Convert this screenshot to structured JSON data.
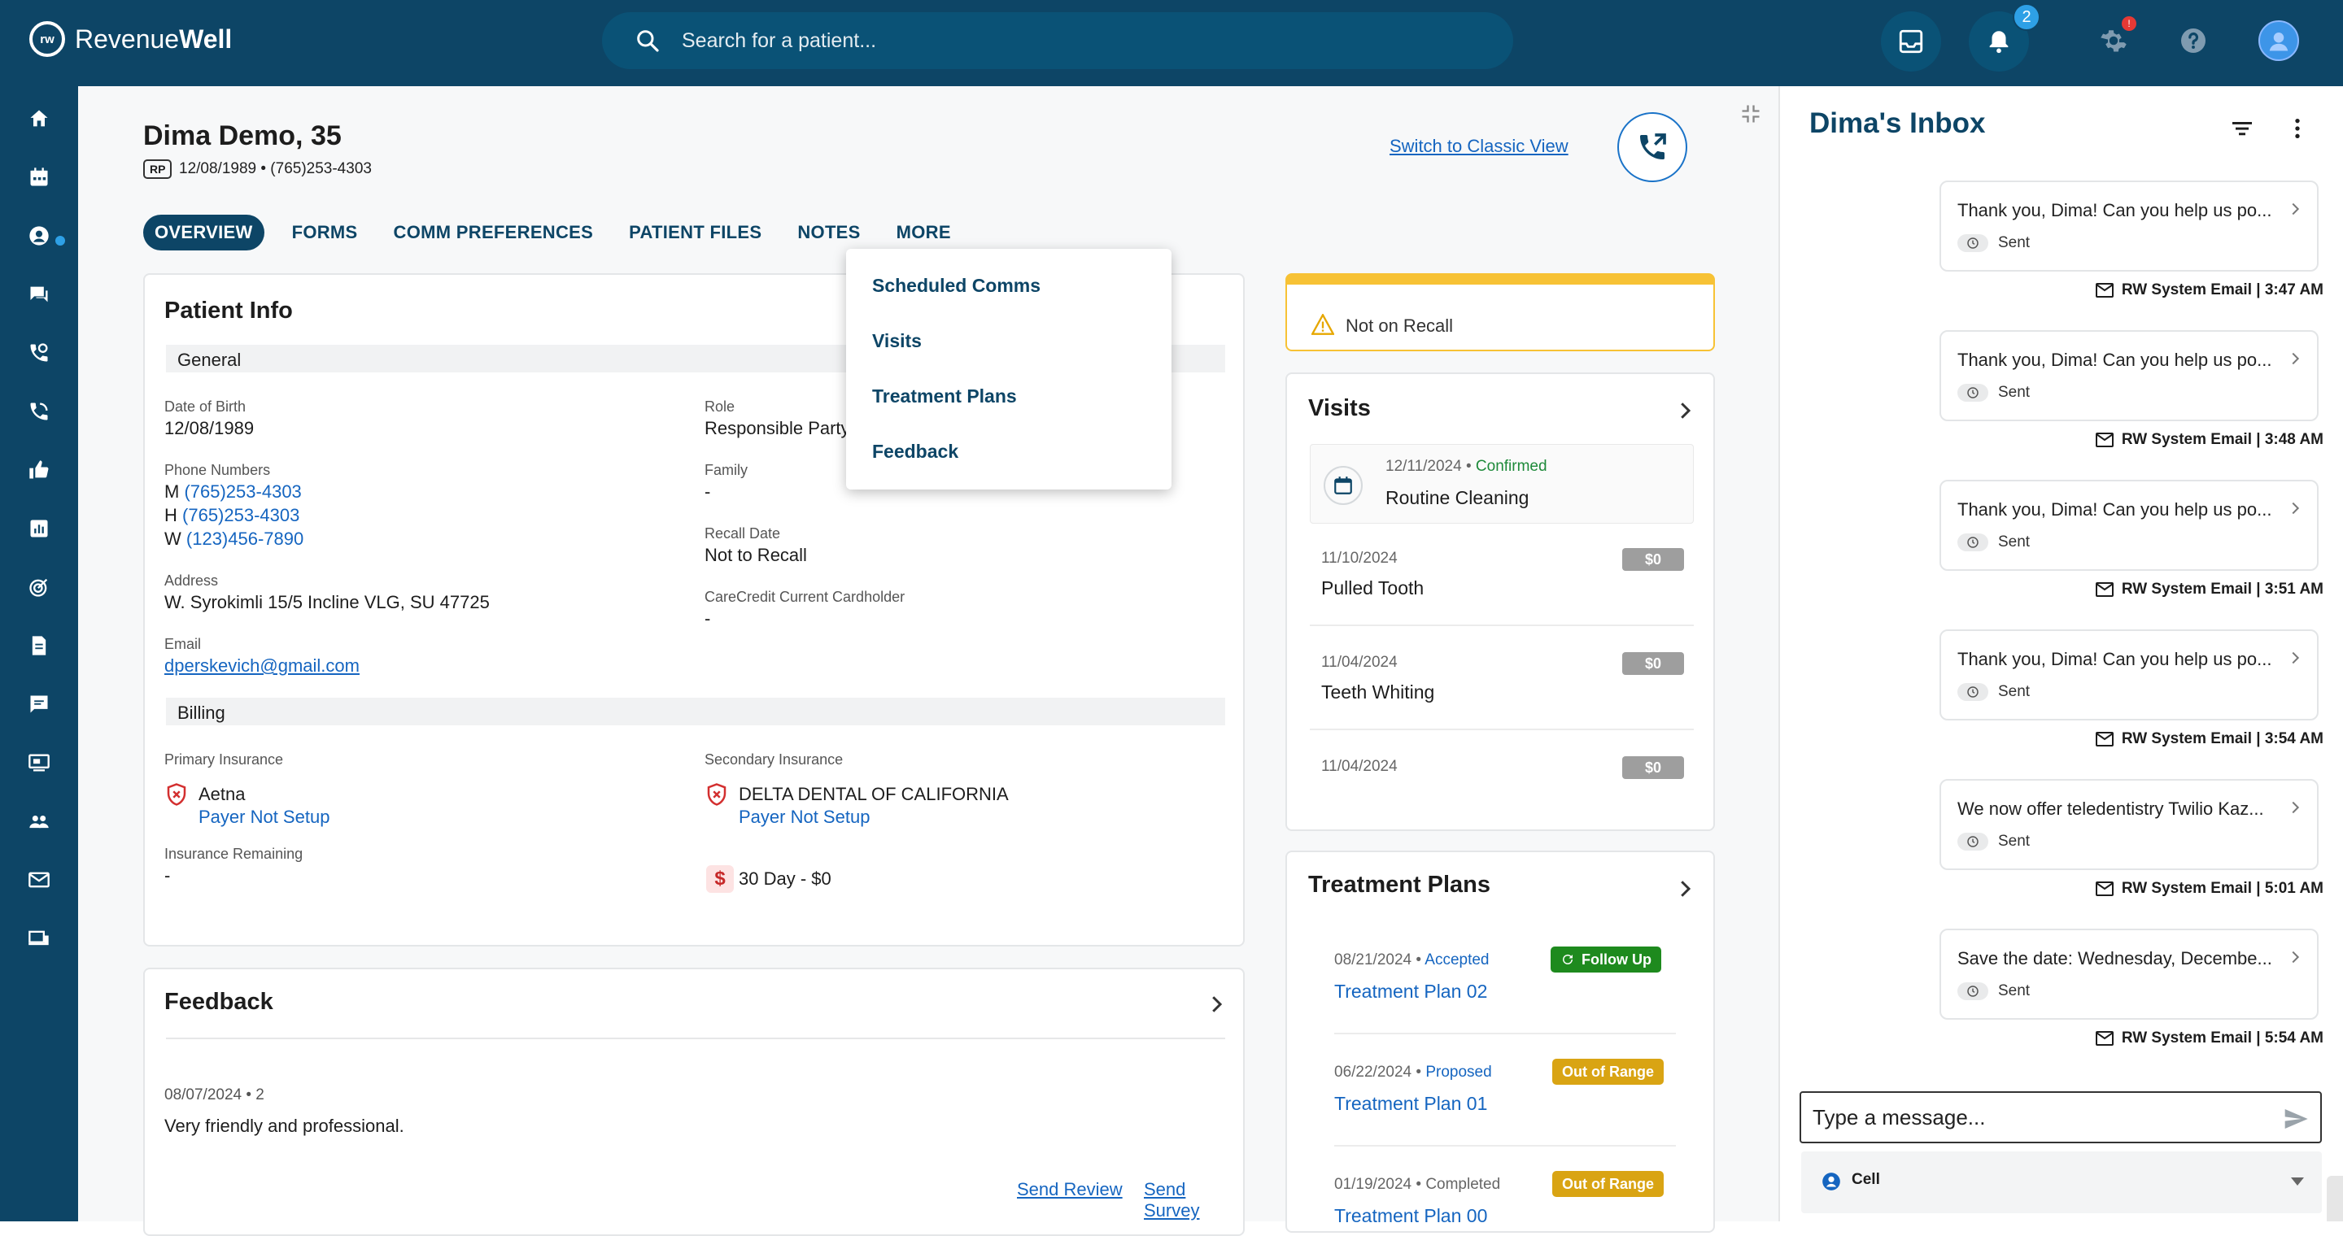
{
  "app": {
    "brand_light": "Revenue",
    "brand_bold": "Well",
    "logo_mark": "rw"
  },
  "search": {
    "placeholder": "Search for a patient..."
  },
  "topbar": {
    "notifications_count": "2",
    "settings_badge": "!"
  },
  "sidebar": {
    "items": [
      "home-icon",
      "calendar-icon",
      "patient-icon",
      "chat-icon",
      "phone-icon",
      "phone-sync-icon",
      "thumbs-up-icon",
      "reports-icon",
      "target-icon",
      "document-icon",
      "message-icon",
      "screen-icon",
      "group-icon",
      "mail-icon",
      "devices-icon"
    ]
  },
  "patient": {
    "name": "Dima Demo, 35",
    "badge": "RP",
    "dob_phone": "12/08/1989 • (765)253-4303",
    "classic_view": "Switch to Classic View"
  },
  "tabs": [
    "OVERVIEW",
    "FORMS",
    "COMM PREFERENCES",
    "PATIENT FILES",
    "NOTES",
    "MORE"
  ],
  "more_menu": [
    "Scheduled Comms",
    "Visits",
    "Treatment Plans",
    "Feedback"
  ],
  "patient_info": {
    "title": "Patient Info",
    "general": "General",
    "dob_label": "Date of Birth",
    "dob": "12/08/1989",
    "phone_label": "Phone Numbers",
    "phones": [
      {
        "type": "M",
        "number": "(765)253-4303"
      },
      {
        "type": "H",
        "number": "(765)253-4303"
      },
      {
        "type": "W",
        "number": "(123)456-7890"
      }
    ],
    "address_label": "Address",
    "address": "W. Syrokimli 15/5 Incline VLG, SU 47725",
    "email_label": "Email",
    "email": "dperskevich@gmail.com",
    "role_label": "Role",
    "role": "Responsible Party",
    "family_label": "Family",
    "family": "-",
    "recall_label": "Recall Date",
    "recall": "Not to Recall",
    "carecredit_label": "CareCredit Current Cardholder",
    "carecredit": "-",
    "billing": "Billing",
    "primary_label": "Primary Insurance",
    "primary_name": "Aetna",
    "primary_status": "Payer Not Setup",
    "secondary_label": "Secondary Insurance",
    "secondary_name": "DELTA DENTAL OF CALIFORNIA",
    "secondary_status": "Payer Not Setup",
    "remaining_label": "Insurance Remaining",
    "remaining": "-",
    "balance": "30 Day - $0"
  },
  "feedback": {
    "title": "Feedback",
    "date": "08/07/2024 • 2",
    "text": "Very friendly and professional.",
    "send_review": "Send Review",
    "send_survey": "Send Survey"
  },
  "recall": {
    "text": "Not on Recall",
    "color": "#f7c235"
  },
  "visits": {
    "title": "Visits",
    "items": [
      {
        "date": "12/11/2024 •",
        "status": "Confirmed",
        "name": "Routine Cleaning"
      },
      {
        "date": "11/10/2024",
        "amount": "$0",
        "name": "Pulled Tooth"
      },
      {
        "date": "11/04/2024",
        "amount": "$0",
        "name": "Teeth Whiting"
      },
      {
        "date": "11/04/2024",
        "amount": "$0",
        "name": ""
      }
    ]
  },
  "treatment_plans": {
    "title": "Treatment Plans",
    "items": [
      {
        "date": "08/21/2024 •",
        "status": "Accepted",
        "name": "Treatment Plan 02",
        "badge": "Follow Up",
        "badge_color": "#1e8a1e"
      },
      {
        "date": "06/22/2024 •",
        "status": "Proposed",
        "name": "Treatment Plan 01",
        "badge": "Out of Range",
        "badge_color": "#d9a413"
      },
      {
        "date": "01/19/2024 •",
        "status": "Completed",
        "name": "Treatment Plan 00",
        "badge": "Out of Range",
        "badge_color": "#d9a413"
      }
    ]
  },
  "inbox": {
    "title": "Dima's Inbox",
    "sent_label": "Sent",
    "messages": [
      {
        "text": "Thank you, Dima! Can you help us po...",
        "meta": "RW System Email  |  3:47 AM"
      },
      {
        "text": "Thank you, Dima! Can you help us po...",
        "meta": "RW System Email  |  3:48 AM"
      },
      {
        "text": "Thank you, Dima! Can you help us po...",
        "meta": "RW System Email  |  3:51 AM"
      },
      {
        "text": "Thank you, Dima! Can you help us po...",
        "meta": "RW System Email  |  3:54 AM"
      },
      {
        "text": "We now offer teledentistry Twilio Kaz...",
        "meta": "RW System Email  |  5:01 AM"
      },
      {
        "text": "Save the date: Wednesday, Decembe...",
        "meta": "RW System Email  |  5:54 AM"
      }
    ],
    "input_placeholder": "Type a message...",
    "channel": "Cell"
  },
  "colors": {
    "primary": "#0d4566",
    "link": "#1565c0",
    "confirmed": "#1e8a3a",
    "notif": "#2ea0e6"
  }
}
